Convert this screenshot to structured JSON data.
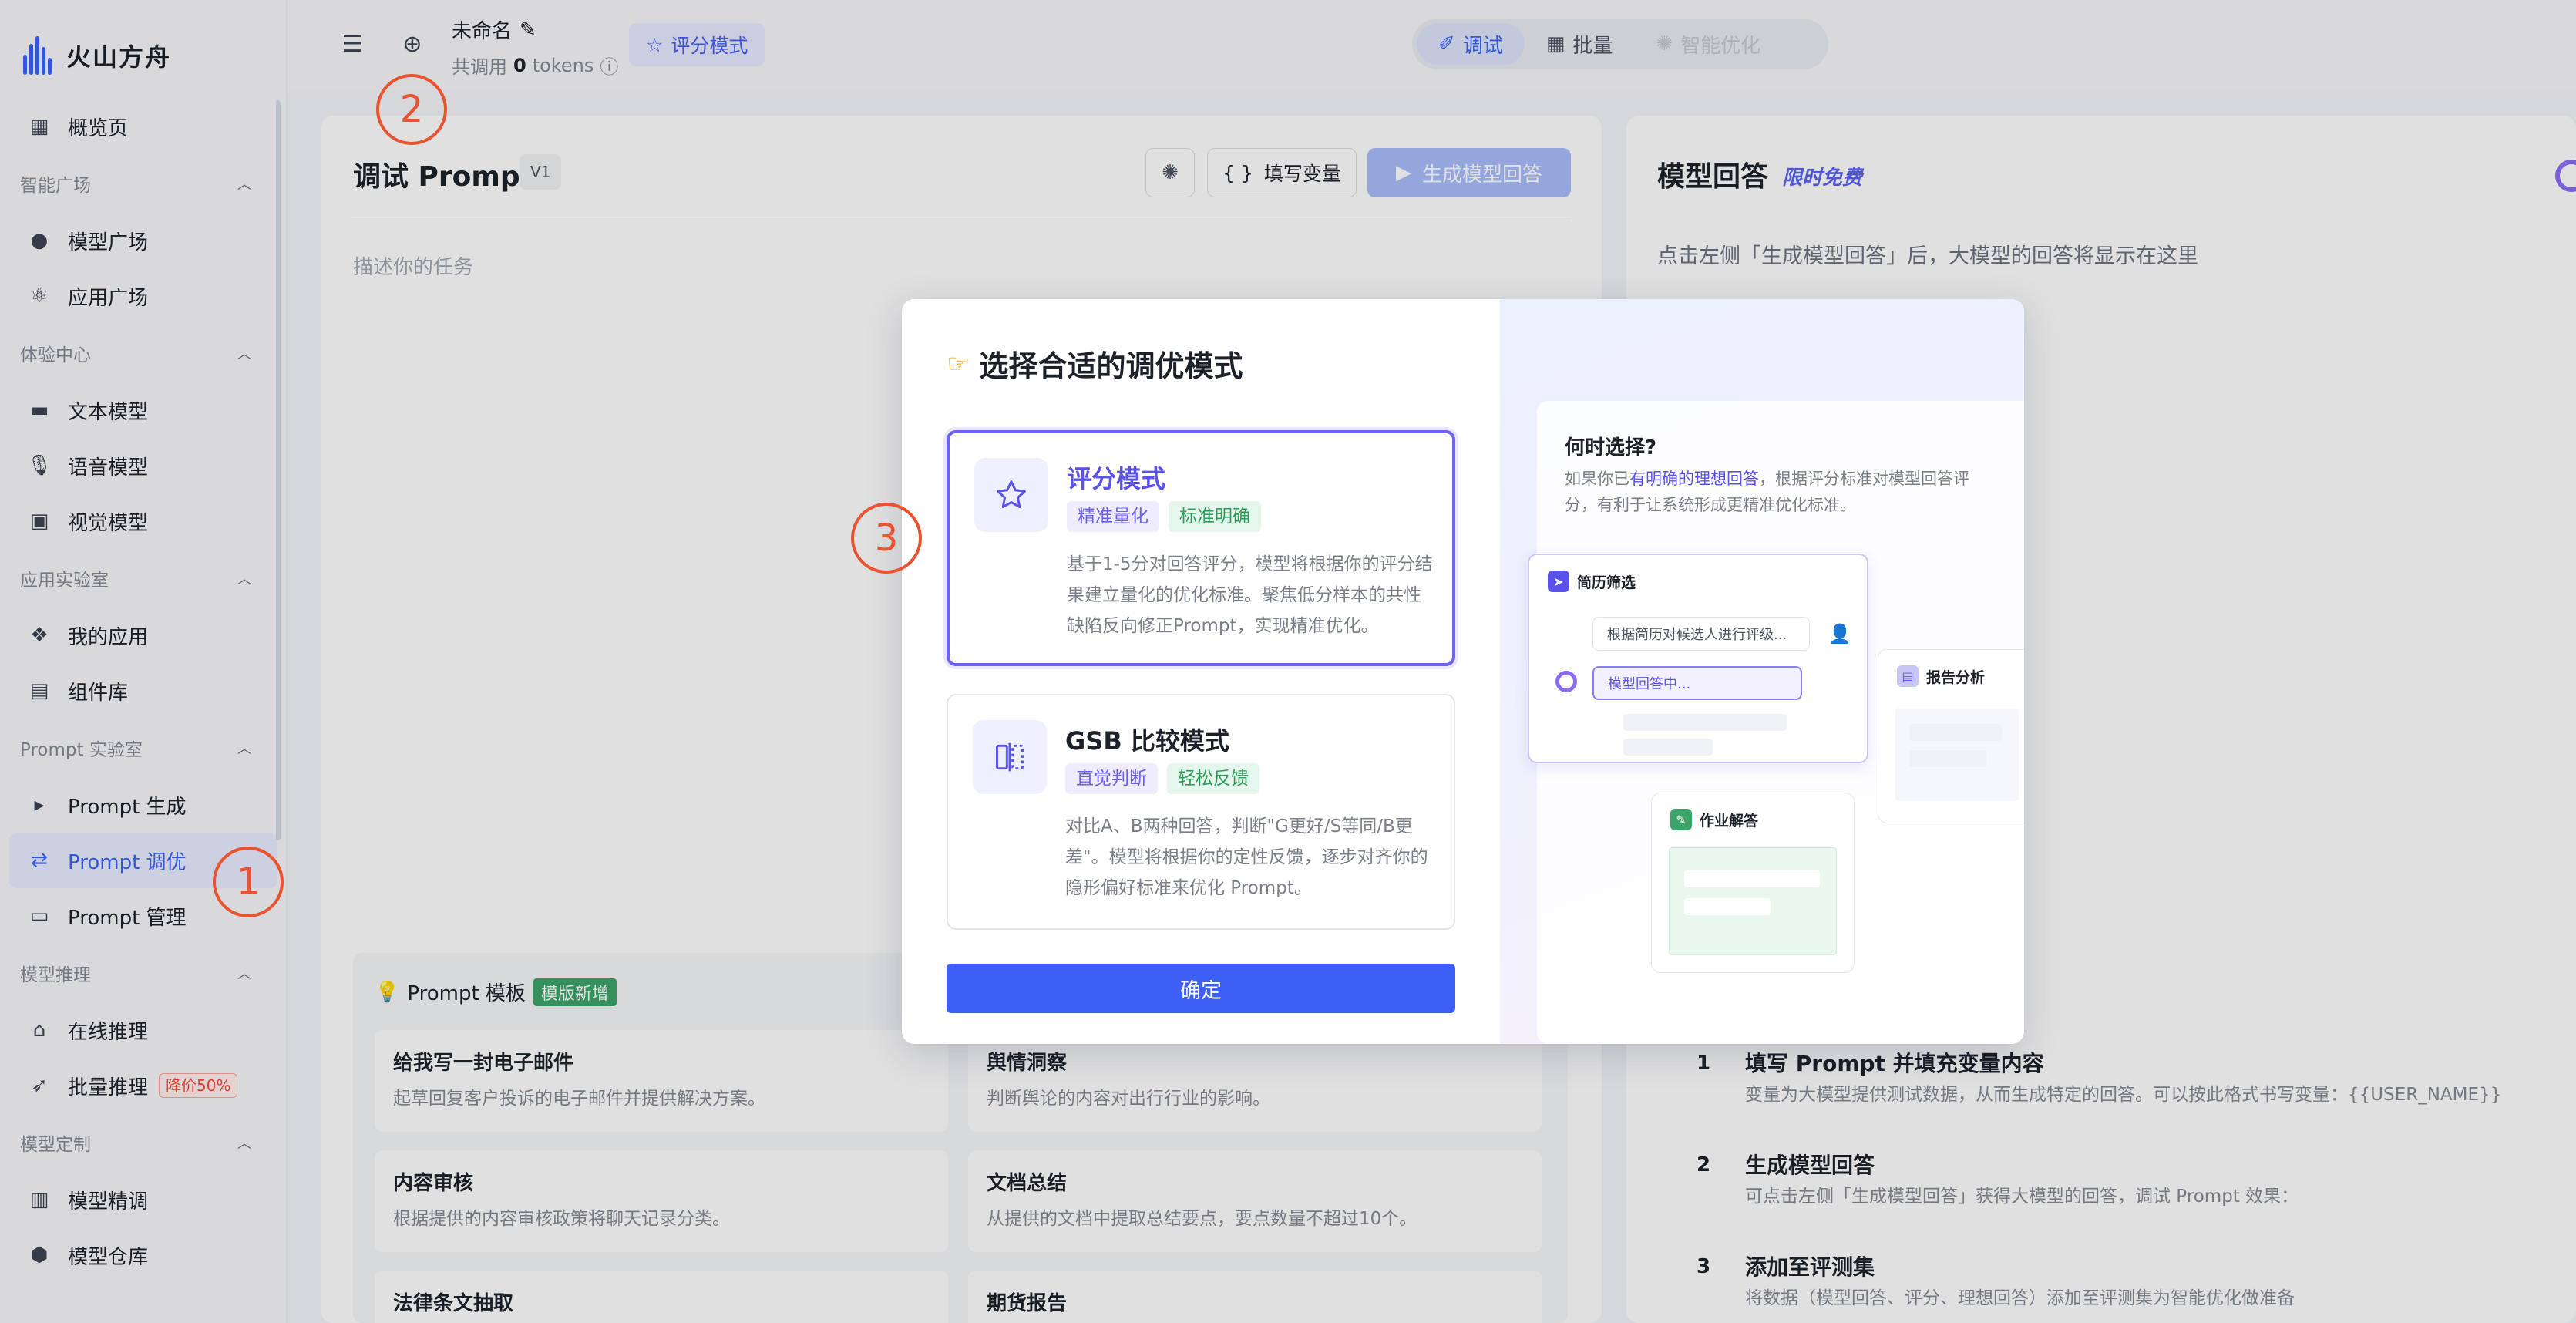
{
  "app": {
    "logo_text": "火山方舟"
  },
  "sidebar": {
    "items": [
      {
        "type": "item",
        "label": "概览页",
        "icon": "dashboard-icon"
      },
      {
        "type": "group",
        "label": "智能广场"
      },
      {
        "type": "item",
        "label": "模型广场",
        "icon": "bulb-icon"
      },
      {
        "type": "item",
        "label": "应用广场",
        "icon": "atom-icon"
      },
      {
        "type": "group",
        "label": "体验中心"
      },
      {
        "type": "item",
        "label": "文本模型",
        "icon": "text-model-icon"
      },
      {
        "type": "item",
        "label": "语音模型",
        "icon": "mic-icon"
      },
      {
        "type": "item",
        "label": "视觉模型",
        "icon": "vision-icon"
      },
      {
        "type": "group",
        "label": "应用实验室"
      },
      {
        "type": "item",
        "label": "我的应用",
        "icon": "apps-icon"
      },
      {
        "type": "item",
        "label": "组件库",
        "icon": "library-icon"
      },
      {
        "type": "group",
        "label": "Prompt 实验室"
      },
      {
        "type": "item",
        "label": "Prompt 生成",
        "icon": "terminal-icon"
      },
      {
        "type": "item",
        "label": "Prompt 调优",
        "icon": "shuffle-icon",
        "active": true
      },
      {
        "type": "item",
        "label": "Prompt 管理",
        "icon": "doc-icon"
      },
      {
        "type": "group",
        "label": "模型推理"
      },
      {
        "type": "item",
        "label": "在线推理",
        "icon": "bank-icon"
      },
      {
        "type": "item",
        "label": "批量推理",
        "icon": "rocket-icon",
        "badge": "降价50%"
      },
      {
        "type": "group",
        "label": "模型定制"
      },
      {
        "type": "item",
        "label": "模型精调",
        "icon": "tune-icon"
      },
      {
        "type": "item",
        "label": "模型仓库",
        "icon": "cube-icon"
      }
    ]
  },
  "topbar": {
    "doc_title": "未命名",
    "usage_prefix": "共调用",
    "usage_count": "0",
    "usage_unit": "tokens",
    "mode_chip": "评分模式",
    "seg_debug": "调试",
    "seg_batch": "批量",
    "seg_smart": "智能优化"
  },
  "left_panel": {
    "title": "调试 Prompt",
    "version": "V1",
    "fill_vars": "填写变量",
    "generate": "生成模型回答",
    "placeholder": "描述你的任务",
    "template_title": "Prompt 模板",
    "template_badge": "模版新增",
    "templates": [
      {
        "title": "给我写一封电子邮件",
        "desc": "起草回复客户投诉的电子邮件并提供解决方案。"
      },
      {
        "title": "舆情洞察",
        "desc": "判断舆论的内容对出行行业的影响。"
      },
      {
        "title": "内容审核",
        "desc": "根据提供的内容审核政策将聊天记录分类。"
      },
      {
        "title": "文档总结",
        "desc": "从提供的文档中提取总结要点，要点数量不超过10个。"
      },
      {
        "title": "法律条文抽取",
        "desc": ""
      },
      {
        "title": "期货报告",
        "desc": ""
      }
    ]
  },
  "right_panel": {
    "title": "模型回答",
    "free_tag": "限时免费",
    "hint": "点击左侧「生成模型回答」后，大模型的回答将显示在这里",
    "steps": [
      {
        "num": "1",
        "title": "填写 Prompt 并填充变量内容",
        "desc": "变量为大模型提供测试数据，从而生成特定的回答。可以按此格式书写变量：{{USER_NAME}}"
      },
      {
        "num": "2",
        "title": "生成模型回答",
        "desc": "可点击左侧「生成模型回答」获得大模型的回答，调试 Prompt 效果："
      },
      {
        "num": "3",
        "title": "添加至评测集",
        "desc": "将数据（模型回答、评分、理想回答）添加至评测集为智能优化做准备"
      }
    ]
  },
  "dialog": {
    "title": "选择合适的调优模式",
    "options": [
      {
        "name": "评分模式",
        "tags": [
          "精准量化",
          "标准明确"
        ],
        "desc": "基于1-5分对回答评分，模型将根据你的评分结果建立量化的优化标准。聚焦低分样本的共性缺陷反向修正Prompt，实现精准优化。",
        "selected": true
      },
      {
        "name": "GSB 比较模式",
        "tags": [
          "直觉判断",
          "轻松反馈"
        ],
        "desc": "对比A、B两种回答，判断\"G更好/S等同/B更差\"。模型将根据你的定性反馈，逐步对齐你的隐形偏好标准来优化 Prompt。",
        "selected": false
      }
    ],
    "confirm": "确定",
    "why": {
      "title": "何时选择?",
      "desc_pre": "如果你已",
      "desc_hl": "有明确的理想回答",
      "desc_post": "，根据评分标准对模型回答评分，有利于让系统形成更精准优化标准。"
    },
    "illustration": {
      "card1_title": "简历筛选",
      "card1_input": "根据简历对候选人进行评级...",
      "card1_output": "模型回答中...",
      "card2_title": "报告分析",
      "card3_title": "作业解答"
    }
  },
  "annotations": [
    "1",
    "2",
    "3"
  ]
}
